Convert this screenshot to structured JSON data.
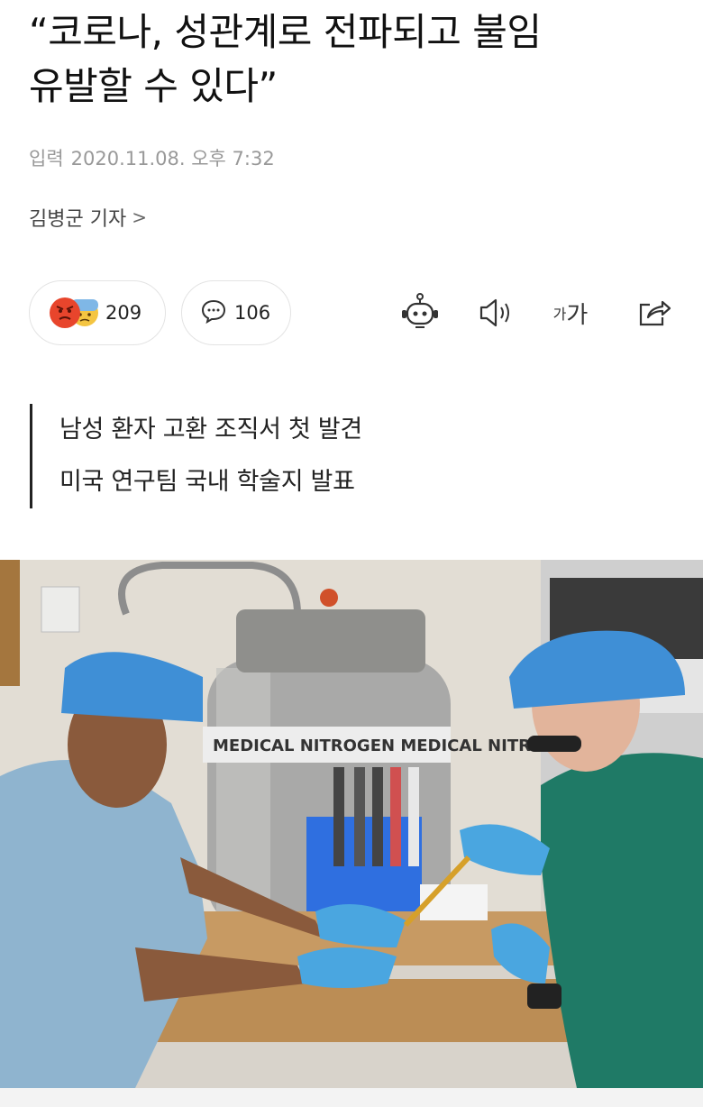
{
  "article": {
    "headline_line1": "“코로나, 성관계로 전파되고 불임",
    "headline_line2": "유발할 수 있다”",
    "meta_label": "입력",
    "published": "2020.11.08. 오후 7:32",
    "reporter": "김병군 기자",
    "reporter_chevron": ">",
    "summary": [
      "남성 환자 고환 조직서 첫 발견",
      "미국 연구팀 국내 학술지 발표"
    ]
  },
  "reactions": {
    "emoji_icons": [
      "angry-face-icon",
      "sad-face-icon"
    ],
    "count": "209"
  },
  "comments": {
    "icon": "speech-bubble-icon",
    "count": "106"
  },
  "toolbar": {
    "robot_icon": "robot-icon",
    "speaker_icon": "speaker-icon",
    "font_small": "가",
    "font_large": "가",
    "share_icon": "share-icon"
  },
  "photo": {
    "cylinder_text": "MEDICAL NITROGEN MEDICAL NITROGEN"
  },
  "colors": {
    "cap_blue": "#3f8fd6",
    "glove_blue": "#4aa6e0",
    "scrubs_teal": "#1f7a66",
    "scrubs_light": "#8fb4cf",
    "rack_blue": "#2f6fe0"
  }
}
